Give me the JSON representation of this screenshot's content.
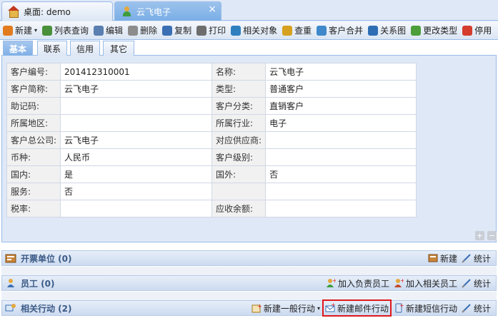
{
  "top_tabs": [
    {
      "label": "桌面: demo",
      "icon": "home-icon"
    },
    {
      "label": "云飞电子",
      "icon": "customer-icon",
      "close": "×"
    }
  ],
  "toolbar": [
    {
      "label": "新建",
      "icon": "new-icon",
      "color": "#e27b1e",
      "dropdown": "▾"
    },
    {
      "label": "列表查询",
      "icon": "list-query-icon",
      "color": "#4a8f3a"
    },
    {
      "label": "编辑",
      "icon": "edit-icon",
      "color": "#5a7fb0"
    },
    {
      "label": "删除",
      "icon": "delete-icon",
      "color": "#8c8c8c"
    },
    {
      "label": "复制",
      "icon": "copy-icon",
      "color": "#3b6fb3"
    },
    {
      "label": "打印",
      "icon": "print-icon",
      "color": "#6d6d6d"
    },
    {
      "label": "相关对象",
      "icon": "related-objects-icon",
      "color": "#2f7fbf"
    },
    {
      "label": "查重",
      "icon": "dedupe-icon",
      "color": "#d6a120"
    },
    {
      "label": "客户合并",
      "icon": "merge-icon",
      "color": "#3f88c9"
    },
    {
      "label": "关系图",
      "icon": "relation-graph-icon",
      "color": "#2e6db4"
    },
    {
      "label": "更改类型",
      "icon": "change-type-icon",
      "color": "#4d9e3a"
    },
    {
      "label": "停用",
      "icon": "disable-icon",
      "color": "#d43c2c"
    }
  ],
  "sub_tabs": [
    "基本",
    "联系",
    "信用",
    "其它"
  ],
  "form_rows": [
    {
      "l1": "客户编号:",
      "v1": "201412310001",
      "l2": "名称:",
      "v2": "云飞电子"
    },
    {
      "l1": "客户简称:",
      "v1": "云飞电子",
      "l2": "类型:",
      "v2": "普通客户"
    },
    {
      "l1": "助记码:",
      "v1": "",
      "l2": "客户分类:",
      "v2": "直销客户"
    },
    {
      "l1": "所属地区:",
      "v1": "",
      "l2": "所属行业:",
      "v2": "电子"
    },
    {
      "l1": "客户总公司:",
      "v1": "云飞电子",
      "l2": "对应供应商:",
      "v2": ""
    },
    {
      "l1": "币种:",
      "v1": "人民币",
      "l2": "客户级别:",
      "v2": ""
    },
    {
      "l1": "国内:",
      "v1": "是",
      "l2": "国外:",
      "v2": "否"
    },
    {
      "l1": "服务:",
      "v1": "否",
      "l2": "",
      "v2": ""
    },
    {
      "l1": "税率:",
      "v1": "",
      "l2": "应收余额:",
      "v2": ""
    }
  ],
  "panel_buttons": {
    "expand": "+",
    "collapse": "−"
  },
  "sections": {
    "invoice": {
      "title": "开票单位 (0)",
      "new": "新建",
      "stats": "统计"
    },
    "staff": {
      "title": "员工 (0)",
      "add_owner": "加入负责员工",
      "add_related": "加入相关员工",
      "stats": "统计"
    },
    "actions": {
      "title": "相关行动 (2)",
      "new_general": "新建一般行动",
      "new_email": "新建邮件行动",
      "new_sms": "新建短信行动",
      "stats": "统计",
      "dropdown": "▾"
    }
  }
}
